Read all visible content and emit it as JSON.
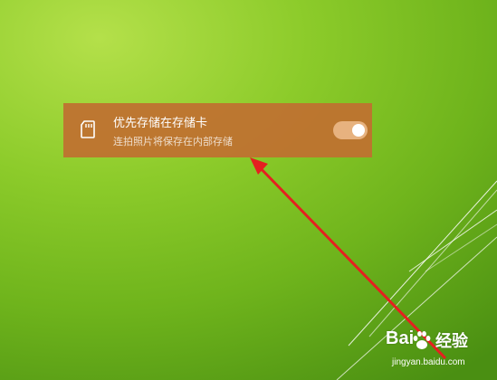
{
  "setting": {
    "title": "优先存储在存储卡",
    "subtitle": "连拍照片将保存在内部存储",
    "toggle_on": true,
    "icon": "sd-card-icon"
  },
  "watermark": {
    "brand_left": "Bai",
    "brand_right": "经验",
    "url": "jingyan.baidu.com"
  },
  "colors": {
    "card": "#c07030",
    "arrow": "#e52020",
    "background": "#8ccb2a"
  }
}
